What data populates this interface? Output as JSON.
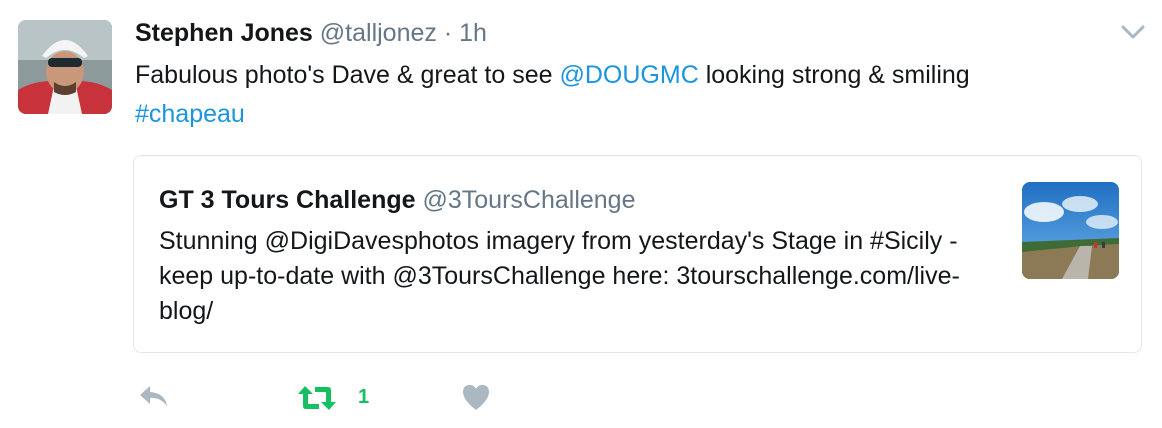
{
  "tweet": {
    "author_name": "Stephen Jones",
    "author_handle": "@talljonez",
    "separator": "·",
    "time": "1h",
    "text_1": "Fabulous photo's Dave & great to see ",
    "mention": "@DOUGMC",
    "text_2": " looking strong & smiling",
    "hashtag": "#chapeau"
  },
  "quoted_tweet": {
    "author_name": "GT 3 Tours Challenge",
    "author_handle": "@3ToursChallenge",
    "text": "Stunning @DigiDavesphotos imagery from yesterday's Stage in #Sicily - keep up-to-date with @3ToursChallenge here: 3tourschallenge.com/live-blog/"
  },
  "actions": {
    "retweet_count": "1"
  },
  "icons": {
    "menu": "chevron-down-icon",
    "reply": "reply-icon",
    "retweet": "retweet-icon",
    "like": "heart-icon"
  },
  "colors": {
    "link": "#1b95e0",
    "retweet_active": "#17bf63",
    "muted": "#aab8c2",
    "secondary_text": "#657786"
  }
}
